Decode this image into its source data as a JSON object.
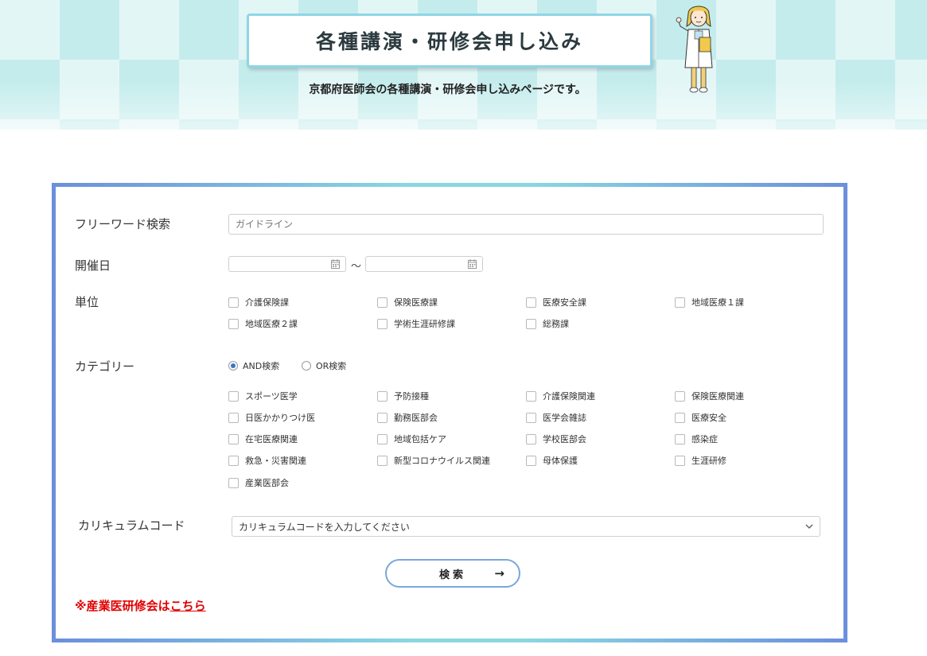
{
  "header": {
    "title": "各種講演・研修会申し込み",
    "subtitle": "京都府医師会の各種講演・研修会申し込みページです。"
  },
  "form": {
    "freeword": {
      "label": "フリーワード検索",
      "placeholder": "ガイドライン",
      "value": ""
    },
    "date": {
      "label": "開催日",
      "separator": "〜"
    },
    "unit": {
      "label": "単位",
      "options": [
        "介護保険課",
        "保険医療課",
        "医療安全課",
        "地域医療１課",
        "地域医療２課",
        "学術生涯研修課",
        "総務課"
      ]
    },
    "category": {
      "label": "カテゴリー",
      "mode_and": "AND検索",
      "mode_or": "OR検索",
      "selected_mode": "AND",
      "options": [
        "スポーツ医学",
        "予防接種",
        "介護保険関連",
        "保険医療関連",
        "日医かかりつけ医",
        "勤務医部会",
        "医学会雑誌",
        "医療安全",
        "在宅医療関連",
        "地域包括ケア",
        "学校医部会",
        "感染症",
        "救急・災害関連",
        "新型コロナウイルス関連",
        "母体保護",
        "生涯研修",
        "産業医部会"
      ]
    },
    "curriculum": {
      "label": "カリキュラムコード",
      "placeholder": "カリキュラムコードを入力してください"
    },
    "search_button": "検索",
    "search_arrow": "→",
    "note_prefix": "※産業医研修会は",
    "note_link": "こちら"
  },
  "colors": {
    "frame_start": "#6b8fdc",
    "frame_mid": "#8ad7e3",
    "note": "#e00000",
    "radio_on": "#3a73c9"
  }
}
